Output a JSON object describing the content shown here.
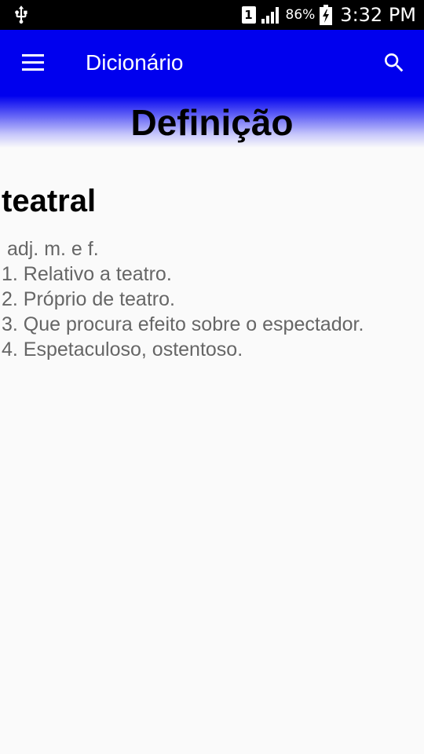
{
  "status_bar": {
    "sim_slot": "1",
    "battery_percent": "86%",
    "time": "3:32 PM",
    "icons": [
      "usb-icon",
      "sim-icon",
      "signal-icon",
      "battery-charging-icon"
    ]
  },
  "app_bar": {
    "title": "Dicionário",
    "icons": [
      "menu-icon",
      "search-icon"
    ],
    "background_color": "#0000ee"
  },
  "section_title": "Definição",
  "entry": {
    "word": "teatral",
    "lines": [
      " adj. m. e f.",
      "1. Relativo a teatro.",
      "2. Próprio de teatro.",
      "3. Que procura efeito sobre o espectador.",
      "4. Espetaculoso, ostentoso."
    ]
  }
}
